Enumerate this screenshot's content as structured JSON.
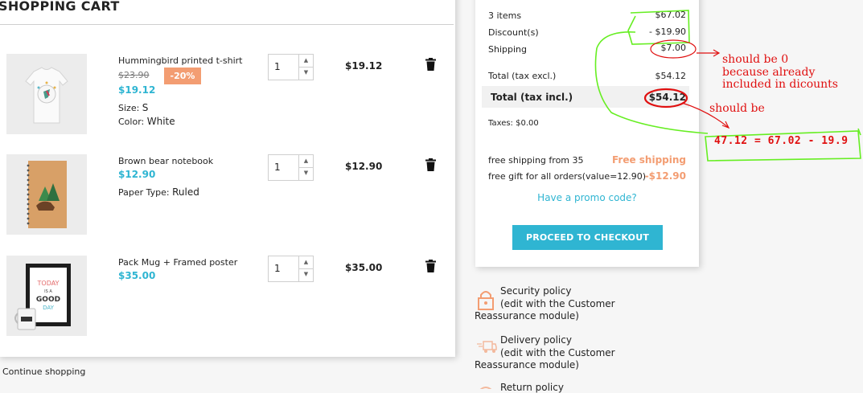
{
  "cart": {
    "title": "SHOPPING CART",
    "continue_label": "Continue shopping",
    "items": [
      {
        "name": "Hummingbird printed t-shirt",
        "old_price": "$23.90",
        "discount_badge": "-20%",
        "price": "$19.12",
        "attr1_label": "Size:",
        "attr1_value": "S",
        "attr2_label": "Color:",
        "attr2_value": "White",
        "quantity": "1",
        "line_total": "$19.12"
      },
      {
        "name": "Brown bear notebook",
        "price": "$12.90",
        "attr1_label": "Paper Type:",
        "attr1_value": "Ruled",
        "quantity": "1",
        "line_total": "$12.90"
      },
      {
        "name": "Pack Mug + Framed poster",
        "price": "$35.00",
        "quantity": "1",
        "line_total": "$35.00"
      }
    ],
    "poster_text": {
      "line1": "TODAY",
      "line2": "IS A",
      "line3": "GOOD",
      "line4": "DAY"
    }
  },
  "summary": {
    "items_label": "3 items",
    "items_value": "$67.02",
    "discount_label": "Discount(s)",
    "discount_value": "- $19.90",
    "shipping_label": "Shipping",
    "shipping_value": "$7.00",
    "total_excl_label": "Total (tax excl.)",
    "total_excl_value": "$54.12",
    "total_incl_label": "Total (tax incl.)",
    "total_incl_value": "$54.12",
    "taxes_label": "Taxes: $0.00",
    "rule1_label": "free shipping from 35",
    "rule1_value": "Free shipping",
    "rule2_label": "free gift for all orders(value=12.90)",
    "rule2_value": "-$12.90",
    "promo_label": "Have a promo code?",
    "checkout_label": "PROCEED TO CHECKOUT"
  },
  "reassurance": [
    {
      "title": "Security policy",
      "desc": "(edit with the Customer Reassurance module)",
      "icon": "lock-icon"
    },
    {
      "title": "Delivery policy",
      "desc": "(edit with the Customer Reassurance module)",
      "icon": "truck-icon"
    },
    {
      "title": "Return policy",
      "icon": "return-icon"
    }
  ],
  "annotations": {
    "note1_line1": "should be 0",
    "note1_line2": "because already",
    "note1_line3": "included in dicounts",
    "note2": "should be",
    "formula": "47.12 = 67.02 - 19.9"
  },
  "colors": {
    "accent": "#2fb5d2",
    "discount": "#f39d72",
    "annotation_red": "#e01010",
    "annotation_green": "#66ee22"
  }
}
